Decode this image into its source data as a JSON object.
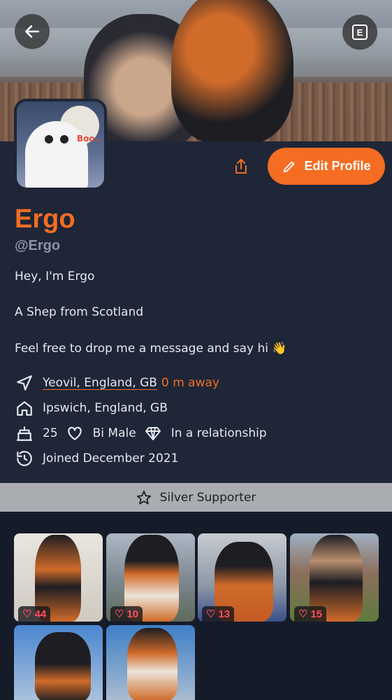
{
  "profile": {
    "display_name": "Ergo",
    "handle": "@Ergo",
    "bio": [
      "Hey, I'm Ergo",
      "A Shep from Scotland",
      "Feel free to drop me a message and say hi 👋"
    ]
  },
  "header": {
    "back_icon": "arrow-left-icon",
    "right_button_label": "E"
  },
  "avatar": {
    "text": "Boo.."
  },
  "actions": {
    "share_icon": "share-icon",
    "edit_label": "Edit Profile",
    "edit_icon": "pencil-icon"
  },
  "details": {
    "location": "Yeovil, England, GB",
    "distance": "0 m away",
    "home": "Ipswich, England, GB",
    "age": "25",
    "orientation": "Bi Male",
    "relationship": "In a relationship",
    "joined": "Joined December 2021"
  },
  "supporter": {
    "label": "Silver Supporter",
    "icon": "star-icon"
  },
  "gallery": [
    {
      "likes": "44"
    },
    {
      "likes": "10"
    },
    {
      "likes": "13"
    },
    {
      "likes": "15"
    },
    {
      "likes": ""
    },
    {
      "likes": ""
    }
  ],
  "colors": {
    "accent": "#f46d22",
    "background": "#151b29",
    "panel": "#1e2637",
    "like": "#ff4f63",
    "supporter_bar": "#a9acb1"
  }
}
